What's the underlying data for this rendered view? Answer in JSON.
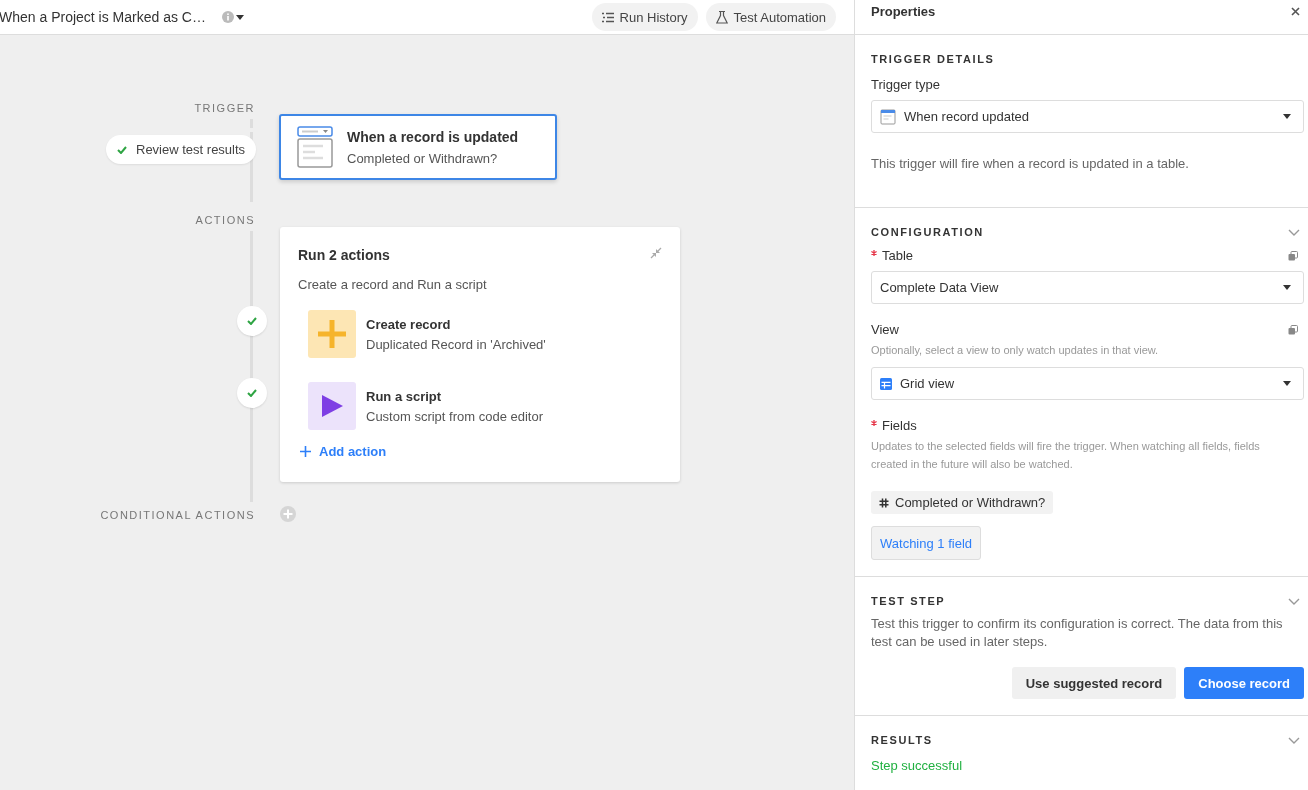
{
  "header": {
    "title": "When a Project is Marked as C…",
    "buttons": [
      {
        "label": "Run History",
        "kind": "history"
      },
      {
        "label": "Test Automation",
        "kind": "test"
      }
    ]
  },
  "canvas": {
    "trigger_label": "TRIGGER",
    "test_badge": "Review test results",
    "trigger_card": {
      "title": "When a record is updated",
      "subtitle": "Completed or Withdrawn?",
      "selected": true
    },
    "actions_label": "ACTIONS",
    "actions_card": {
      "title": "Run 2 actions",
      "subtitle": "Create a record and Run a script",
      "add_label": "Add action",
      "actions": [
        {
          "kind": "create",
          "title": "Create record",
          "subtitle": "Duplicated Record in 'Archived'",
          "completed": true
        },
        {
          "kind": "script",
          "title": "Run a script",
          "subtitle": "Custom script from code editor",
          "completed": true
        }
      ]
    },
    "conditional_label": "CONDITIONAL ACTIONS"
  },
  "properties": {
    "title": "Properties",
    "trigger_details": {
      "heading": "TRIGGER DETAILS",
      "label": "Trigger type",
      "value": "When record updated",
      "description": "This trigger will fire when a record is updated in a table."
    },
    "configuration": {
      "heading": "CONFIGURATION",
      "table": {
        "label": "Table",
        "required": true,
        "value": "Complete Data View"
      },
      "view": {
        "label": "View",
        "required": false,
        "hint": "Optionally, select a view to only watch updates in that view.",
        "value": "Grid view"
      },
      "fields": {
        "label": "Fields",
        "required": true,
        "hint": "Updates to the selected fields will fire the trigger. When watching all fields, fields created in the future will also be watched.",
        "chips": [
          "Completed or Withdrawn?"
        ],
        "button": "Watching 1 field"
      }
    },
    "test_step": {
      "heading": "TEST STEP",
      "description": "Test this trigger to confirm its configuration is correct. The data from this test can be used in later steps.",
      "buttons": [
        {
          "label": "Use suggested record",
          "kind": "secondary"
        },
        {
          "label": "Choose record",
          "kind": "primary"
        }
      ]
    },
    "results": {
      "heading": "RESULTS",
      "status": "Step successful"
    }
  }
}
